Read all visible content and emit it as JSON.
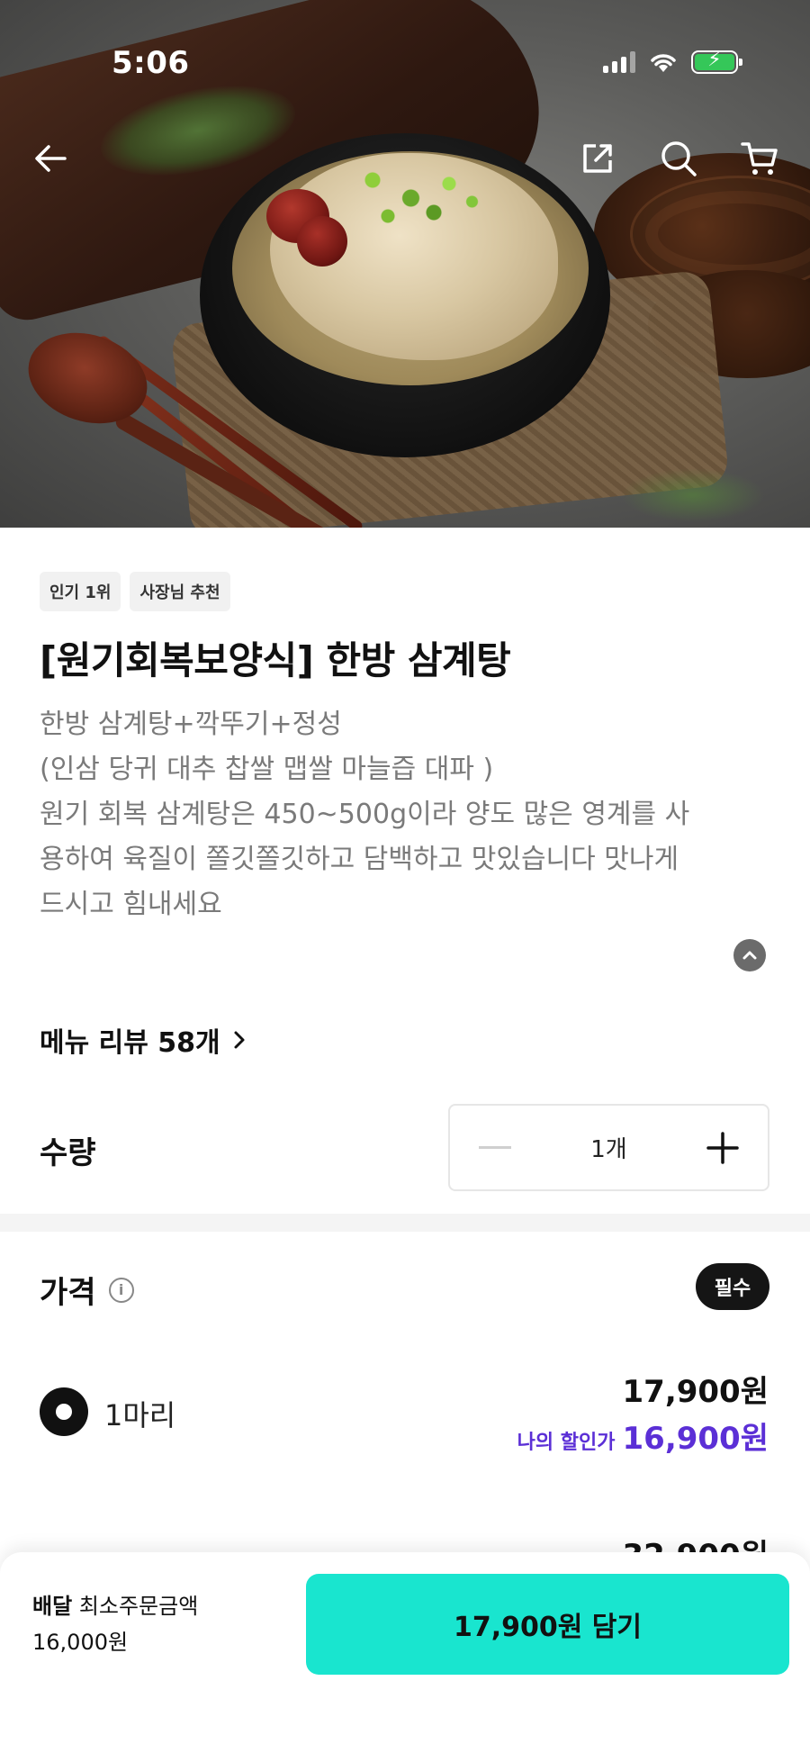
{
  "status_bar": {
    "time": "5:06"
  },
  "badges": [
    "인기 1위",
    "사장님 추천"
  ],
  "product": {
    "title": "[원기회복보양식] 한방 삼계탕",
    "description_lines": [
      "한방 삼계탕+깍뚜기+정성",
      "(인삼 당귀 대추 찹쌀 맵쌀 마늘즙 대파 )",
      "원기 회복 삼계탕은 450~500g이라 양도 많은 영계를 사",
      "용하여 육질이 쫄깃쫄깃하고 담백하고 맛있습니다 맛나게",
      "드시고 힘내세요"
    ]
  },
  "reviews": {
    "label": "메뉴 리뷰 58개"
  },
  "quantity": {
    "label": "수량",
    "value": "1개"
  },
  "price_section": {
    "label": "가격",
    "required_badge": "필수",
    "options": [
      {
        "label": "1마리",
        "price": "17,900원",
        "discount_label": "나의 할인가",
        "discount_price": "16,900원",
        "selected": true
      },
      {
        "label": "",
        "price": "32,900원",
        "selected": false
      }
    ]
  },
  "bottom_bar": {
    "delivery_label": "배달",
    "min_order_label": "최소주문금액",
    "min_order_value": "16,000원",
    "cart_button": "17,900원 담기"
  },
  "colors": {
    "accent_mint": "#19e5cf",
    "discount_purple": "#5b2fd6",
    "battery_green": "#35c759"
  },
  "icons": [
    "back-arrow-icon",
    "share-icon",
    "search-icon",
    "cart-icon",
    "chevron-up-icon",
    "chevron-right-icon",
    "info-icon",
    "minus-icon",
    "plus-icon"
  ]
}
